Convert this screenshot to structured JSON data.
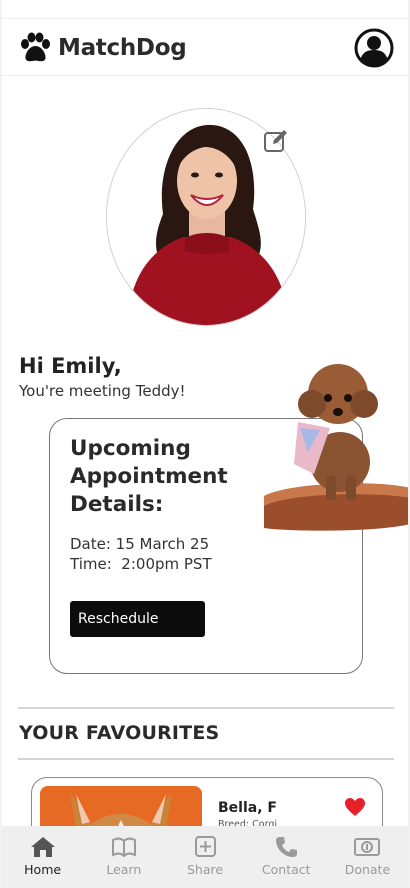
{
  "app": {
    "name": "MatchDog"
  },
  "greeting": {
    "title": "Hi Emily,",
    "subtitle": "You're meeting Teddy!"
  },
  "appointment": {
    "title": "Upcoming Appointment Details:",
    "date": "Date: 15 March 25",
    "time": "Time:  2:00pm PST",
    "reschedule_label": "Reschedule"
  },
  "favourites": {
    "title": "YOUR FAVOURITES",
    "items": [
      {
        "name": "Bella, F",
        "breed": "Breed: Corgi",
        "favourited": true
      }
    ]
  },
  "nav": {
    "items": [
      {
        "label": "Home",
        "icon": "home-icon",
        "active": true
      },
      {
        "label": "Learn",
        "icon": "book-icon",
        "active": false
      },
      {
        "label": "Share",
        "icon": "plus-square-icon",
        "active": false
      },
      {
        "label": "Contact",
        "icon": "phone-icon",
        "active": false
      },
      {
        "label": "Donate",
        "icon": "money-icon",
        "active": false
      }
    ]
  },
  "colors": {
    "accent": "#0c0c0c",
    "heart": "#e8202a",
    "corgi_bg": "#e66a24"
  }
}
